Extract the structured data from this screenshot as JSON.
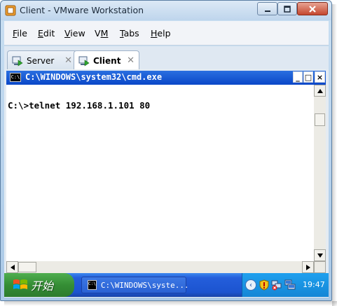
{
  "window": {
    "title": "Client - VMware Workstation",
    "controls": {
      "minimize": "minimize-icon",
      "maximize": "maximize-icon",
      "close": "close-icon"
    }
  },
  "menu": {
    "items": [
      {
        "label": "File",
        "underline": "F",
        "rest": "ile"
      },
      {
        "label": "Edit",
        "underline": "E",
        "rest": "dit"
      },
      {
        "label": "View",
        "underline": "V",
        "rest": "iew"
      },
      {
        "label": "VM",
        "underline": "M",
        "rest": "V"
      },
      {
        "label": "Tabs",
        "underline": "T",
        "rest": "abs"
      },
      {
        "label": "Help",
        "underline": "H",
        "rest": "elp"
      }
    ]
  },
  "tabs": [
    {
      "label": "Server",
      "active": false
    },
    {
      "label": "Client",
      "active": true
    }
  ],
  "console": {
    "title": "C:\\WINDOWS\\system32\\cmd.exe",
    "icon_text": "C:\\",
    "lines": [
      "C:\\>telnet 192.168.1.101 80"
    ],
    "buttons": {
      "min": "_",
      "max": "□",
      "close": "×"
    }
  },
  "taskbar": {
    "start_label": "开始",
    "task_item": "C:\\WINDOWS\\syste...",
    "clock": "19:47"
  },
  "colors": {
    "console_titlebar": "#0a47c8",
    "taskbar": "#245edb",
    "start_button": "#358e35",
    "tray": "#1486d6"
  }
}
